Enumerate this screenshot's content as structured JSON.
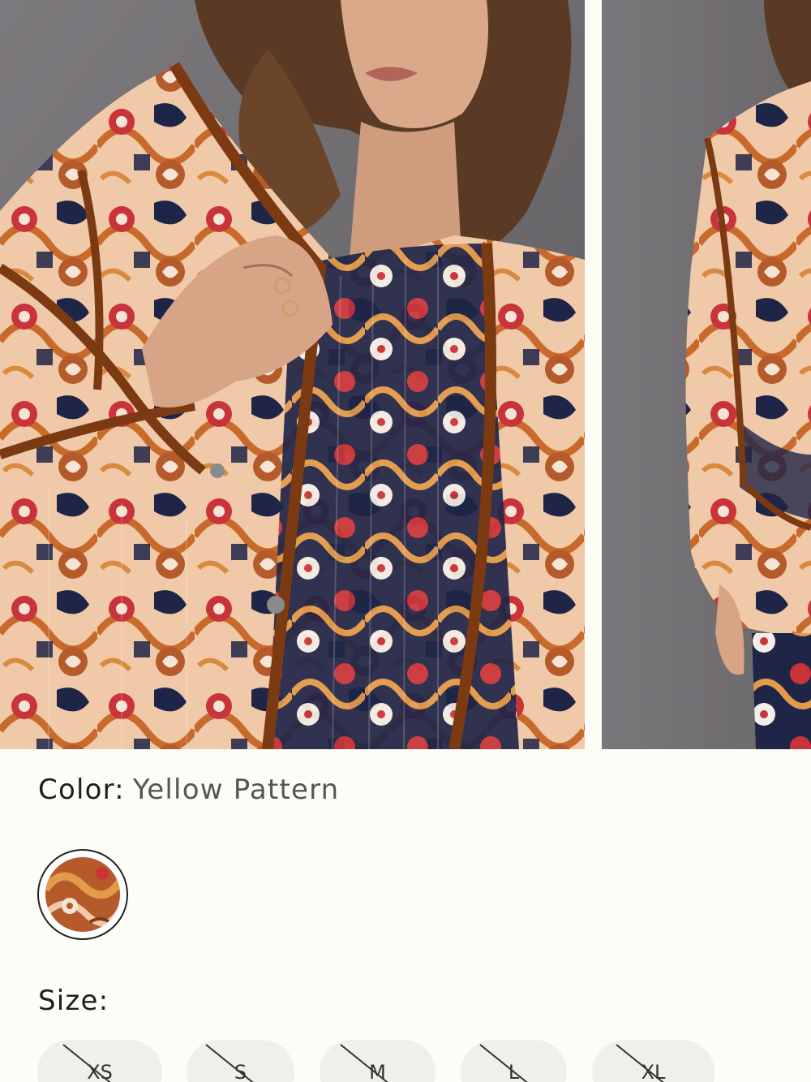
{
  "product": {
    "color_label": "Color:",
    "color_value": "Yellow Pattern",
    "size_label": "Size:",
    "swatches": [
      {
        "name": "Yellow Pattern",
        "selected": true
      }
    ],
    "sizes": [
      {
        "label": "XS",
        "available": false
      },
      {
        "label": "S",
        "available": false
      },
      {
        "label": "M",
        "available": false
      },
      {
        "label": "L",
        "available": false
      },
      {
        "label": "XL",
        "available": false
      }
    ]
  },
  "colors": {
    "background": "#fdfdf8",
    "text": "#1e1e1e",
    "muted_text": "#555555",
    "size_chip": "#f0efea",
    "jacket_navy": "#1f2547",
    "jacket_rust": "#b55a2a",
    "jacket_red": "#c9333a",
    "jacket_peach": "#f0c9a8",
    "backdrop": "#6f6c70"
  }
}
